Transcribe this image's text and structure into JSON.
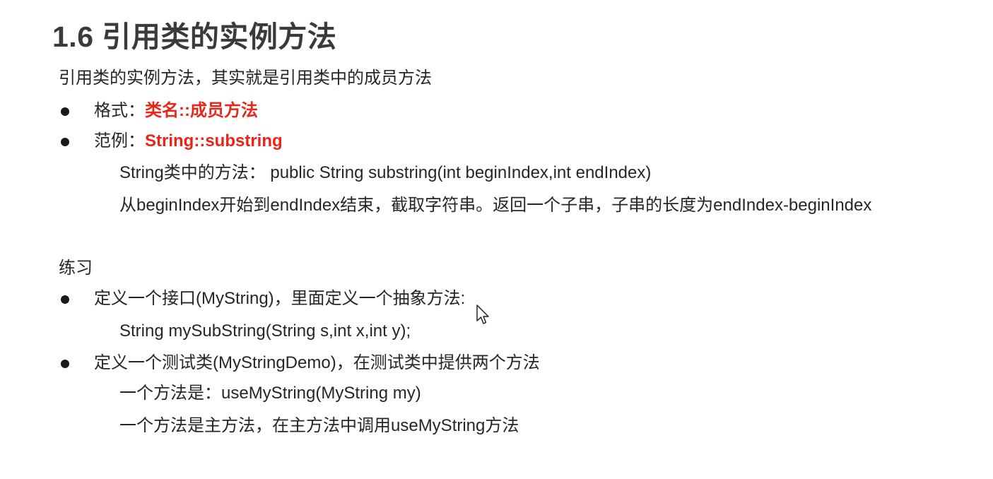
{
  "title": "1.6 引用类的实例方法",
  "intro": "引用类的实例方法，其实就是引用类中的成员方法",
  "bullets": {
    "format_label": "格式：",
    "format_value": "类名::成员方法",
    "example_label": "范例：",
    "example_value": "String::substring"
  },
  "example_lines": [
    "String类中的方法：  public String substring(int beginIndex,int endIndex)",
    "从beginIndex开始到endIndex结束，截取字符串。返回一个子串，子串的长度为endIndex-beginIndex"
  ],
  "practice": {
    "heading": "练习",
    "item1": "定义一个接口(MyString)，里面定义一个抽象方法:",
    "item1_sub": "String mySubString(String s,int x,int y);",
    "item2": "定义一个测试类(MyStringDemo)，在测试类中提供两个方法",
    "item2_sub1": "一个方法是：useMyString(MyString my)",
    "item2_sub2": "一个方法是主方法，在主方法中调用useMyString方法"
  },
  "colors": {
    "accent_red": "#e8251a",
    "text": "#262626",
    "title": "#3a3a3a"
  },
  "icons": {
    "bullet": "filled-circle",
    "pointer": "mouse-pointer-icon"
  }
}
